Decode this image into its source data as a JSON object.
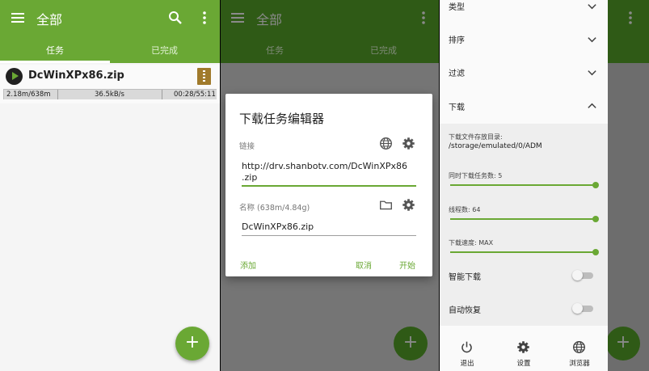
{
  "colors": {
    "accent": "#6aa834",
    "accent_dark": "#2f5a16",
    "surface": "#fafafa",
    "overlay": "#757575"
  },
  "icons": {
    "menu": "menu-icon",
    "search": "search-icon",
    "more": "more-vert-icon",
    "play": "play-icon",
    "archive": "zip-archive-icon",
    "globe": "globe-icon",
    "gear": "gear-icon",
    "folder": "folder-icon",
    "chevron_down": "chevron-down-icon",
    "chevron_up": "chevron-up-icon",
    "power": "power-icon",
    "add": "add-icon"
  },
  "toolbar": {
    "title": "全部"
  },
  "tabs": [
    {
      "label": "任务",
      "selected": true
    },
    {
      "label": "已完成",
      "selected": false
    }
  ],
  "task": {
    "name": "DcWinXPx86.zip",
    "progress_text": "2.18m/638m",
    "speed": "36.5kB/s",
    "time": "00:28/55:11",
    "progress_fraction": 0.0034
  },
  "fab": {
    "symbol": "+"
  },
  "dialog": {
    "title": "下载任务编辑器",
    "link_label": "链接",
    "link_value_line1": "http://drv.shanbotv.com/DcWinXPx86",
    "link_value_line2": ".zip",
    "name_label": "名称 (638m/4.84g)",
    "name_value": "DcWinXPx86.zip",
    "add_button": "添加",
    "cancel_button": "取消",
    "start_button": "开始"
  },
  "settings": {
    "sections": {
      "type": "类型",
      "sort": "排序",
      "filter": "过滤",
      "download": "下载"
    },
    "download_dir_label": "下载文件存放目录:",
    "download_dir_value": "/storage/emulated/0/ADM",
    "concurrent_label": "同时下载任务数: 5",
    "concurrent_level": 1.0,
    "threads_label": "线程数: 64",
    "threads_level": 1.0,
    "speed_label": "下载速度: MAX",
    "speed_level": 1.0,
    "smart_download_label": "智能下载",
    "smart_download_on": false,
    "auto_resume_label": "自动恢复",
    "auto_resume_on": false
  },
  "bottom_nav": [
    {
      "label": "退出",
      "icon": "power-icon"
    },
    {
      "label": "设置",
      "icon": "gear-icon"
    },
    {
      "label": "浏览器",
      "icon": "globe-icon"
    }
  ]
}
